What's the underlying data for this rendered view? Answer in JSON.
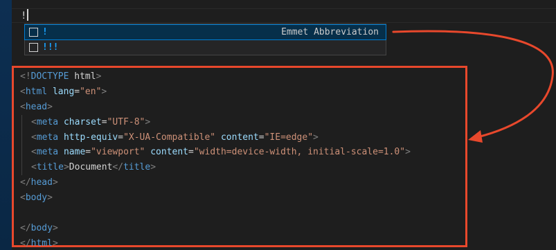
{
  "editor": {
    "typed_text": "!"
  },
  "suggest": {
    "items": [
      {
        "label": "!",
        "detail": "Emmet Abbreviation",
        "selected": true
      },
      {
        "label": "!!!",
        "detail": "",
        "selected": false
      }
    ]
  },
  "code": {
    "lines": [
      [
        {
          "t": "punc",
          "v": "<!"
        },
        {
          "t": "doctype",
          "v": "DOCTYPE"
        },
        {
          "t": "text",
          "v": " html"
        },
        {
          "t": "punc",
          "v": ">"
        }
      ],
      [
        {
          "t": "punc",
          "v": "<"
        },
        {
          "t": "tag",
          "v": "html"
        },
        {
          "t": "text",
          "v": " "
        },
        {
          "t": "attr",
          "v": "lang"
        },
        {
          "t": "text",
          "v": "="
        },
        {
          "t": "str",
          "v": "\"en\""
        },
        {
          "t": "punc",
          "v": ">"
        }
      ],
      [
        {
          "t": "punc",
          "v": "<"
        },
        {
          "t": "tag",
          "v": "head"
        },
        {
          "t": "punc",
          "v": ">"
        }
      ],
      [
        {
          "t": "indent"
        },
        {
          "t": "punc",
          "v": "<"
        },
        {
          "t": "tag",
          "v": "meta"
        },
        {
          "t": "text",
          "v": " "
        },
        {
          "t": "attr",
          "v": "charset"
        },
        {
          "t": "text",
          "v": "="
        },
        {
          "t": "str",
          "v": "\"UTF-8\""
        },
        {
          "t": "punc",
          "v": ">"
        }
      ],
      [
        {
          "t": "indent"
        },
        {
          "t": "punc",
          "v": "<"
        },
        {
          "t": "tag",
          "v": "meta"
        },
        {
          "t": "text",
          "v": " "
        },
        {
          "t": "attr",
          "v": "http-equiv"
        },
        {
          "t": "text",
          "v": "="
        },
        {
          "t": "str",
          "v": "\"X-UA-Compatible\""
        },
        {
          "t": "text",
          "v": " "
        },
        {
          "t": "attr",
          "v": "content"
        },
        {
          "t": "text",
          "v": "="
        },
        {
          "t": "str",
          "v": "\"IE=edge\""
        },
        {
          "t": "punc",
          "v": ">"
        }
      ],
      [
        {
          "t": "indent"
        },
        {
          "t": "punc",
          "v": "<"
        },
        {
          "t": "tag",
          "v": "meta"
        },
        {
          "t": "text",
          "v": " "
        },
        {
          "t": "attr",
          "v": "name"
        },
        {
          "t": "text",
          "v": "="
        },
        {
          "t": "str",
          "v": "\"viewport\""
        },
        {
          "t": "text",
          "v": " "
        },
        {
          "t": "attr",
          "v": "content"
        },
        {
          "t": "text",
          "v": "="
        },
        {
          "t": "str",
          "v": "\"width=device-width, initial-scale=1.0\""
        },
        {
          "t": "punc",
          "v": ">"
        }
      ],
      [
        {
          "t": "indent"
        },
        {
          "t": "punc",
          "v": "<"
        },
        {
          "t": "tag",
          "v": "title"
        },
        {
          "t": "punc",
          "v": ">"
        },
        {
          "t": "text",
          "v": "Document"
        },
        {
          "t": "punc",
          "v": "</"
        },
        {
          "t": "tag",
          "v": "title"
        },
        {
          "t": "punc",
          "v": ">"
        }
      ],
      [
        {
          "t": "punc",
          "v": "</"
        },
        {
          "t": "tag",
          "v": "head"
        },
        {
          "t": "punc",
          "v": ">"
        }
      ],
      [
        {
          "t": "punc",
          "v": "<"
        },
        {
          "t": "tag",
          "v": "body"
        },
        {
          "t": "punc",
          "v": ">"
        }
      ],
      [],
      [
        {
          "t": "punc",
          "v": "</"
        },
        {
          "t": "tag",
          "v": "body"
        },
        {
          "t": "punc",
          "v": ">"
        }
      ],
      [
        {
          "t": "punc",
          "v": "</"
        },
        {
          "t": "tag",
          "v": "html"
        },
        {
          "t": "punc",
          "v": ">"
        }
      ]
    ]
  },
  "colors": {
    "highlight_border": "#e8482c",
    "selection_bg": "#062f4a",
    "match_color": "#18a3ff",
    "tag_color": "#569cd6",
    "attr_color": "#9cdcfe",
    "string_color": "#ce9178"
  },
  "icons": {
    "suggestion_icon": "snippet-icon"
  }
}
